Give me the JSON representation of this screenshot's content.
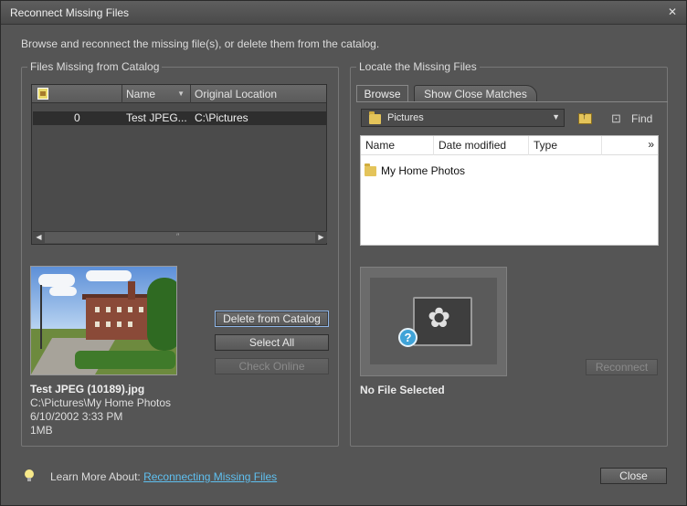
{
  "window": {
    "title": "Reconnect Missing Files"
  },
  "instructions": "Browse and reconnect the missing file(s), or delete them from the catalog.",
  "missing_group": {
    "title": "Files Missing from Catalog",
    "columns": {
      "name": "Name",
      "original_location": "Original Location"
    },
    "rows": [
      {
        "count": "0",
        "name": "Test JPEG...",
        "location": "C:\\Pictures"
      }
    ],
    "scroll_grip": "″"
  },
  "selected_file": {
    "name": "Test JPEG (10189).jpg",
    "path": "C:\\Pictures\\My Home Photos",
    "date": "6/10/2002 3:33 PM",
    "size": "1MB"
  },
  "actions": {
    "delete": "Delete from Catalog",
    "select_all": "Select All",
    "check_online": "Check Online"
  },
  "locate_group": {
    "title": "Locate the Missing Files",
    "tabs": {
      "browse": "Browse",
      "close_matches": "Show Close Matches"
    },
    "location": "Pictures",
    "find": "Find",
    "browser_columns": {
      "name": "Name",
      "date": "Date modified",
      "type": "Type",
      "more": "»"
    },
    "items": [
      {
        "name": "My Home Photos"
      }
    ],
    "reconnect": "Reconnect",
    "preview_status": "No File Selected"
  },
  "footer": {
    "learn_prefix": "Learn More About:",
    "learn_link": "Reconnecting Missing Files",
    "close": "Close"
  },
  "colors": {
    "link": "#5fc0f0",
    "panel": "#555555",
    "selected_row": "#2e2e2e"
  }
}
